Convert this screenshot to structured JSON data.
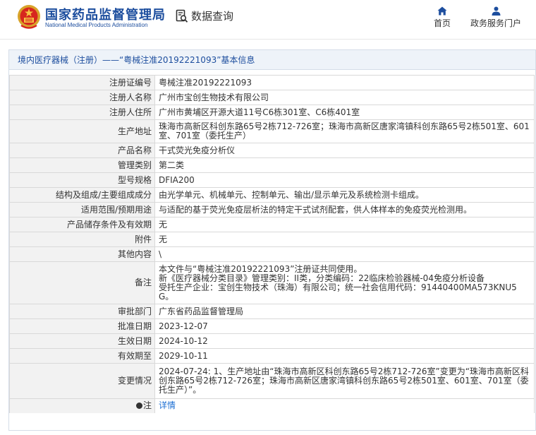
{
  "header": {
    "org_name_cn": "国家药品监督管理局",
    "org_name_en": "National Medical Products Administration",
    "data_query": "数据查询",
    "nav_home": "首页",
    "nav_portal": "政务服务门户"
  },
  "section": {
    "category": "境内医疗器械（注册）",
    "separator": "——",
    "title_rest": "“粤械注准20192221093”基本信息"
  },
  "rows": [
    {
      "label": "注册证编号",
      "value": "粤械注准20192221093"
    },
    {
      "label": "注册人名称",
      "value": "广州市宝创生物技术有限公司"
    },
    {
      "label": "注册人住所",
      "value": "广州市黄埔区开源大道11号C6栋301室、C6栋401室"
    },
    {
      "label": "生产地址",
      "value": "珠海市高新区科创东路65号2栋712-726室；珠海市高新区唐家湾镇科创东路65号2栋501室、601室、701室（委托生产）"
    },
    {
      "label": "产品名称",
      "value": "干式荧光免疫分析仪"
    },
    {
      "label": "管理类别",
      "value": "第二类"
    },
    {
      "label": "型号规格",
      "value": "DFIA200"
    },
    {
      "label": "结构及组成/主要组成成分",
      "value": "由光学单元、机械单元、控制单元、输出/显示单元及系统检测卡组成。"
    },
    {
      "label": "适用范围/预期用途",
      "value": "与适配的基于荧光免疫层析法的特定干式试剂配套，供人体样本的免疫荧光检测用。"
    },
    {
      "label": "产品储存条件及有效期",
      "value": "无"
    },
    {
      "label": "附件",
      "value": "无"
    },
    {
      "label": "其他内容",
      "value": "\\"
    },
    {
      "label": "备注",
      "value": "本文件与“粤械注准20192221093”注册证共同使用。\n新《医疗器械分类目录》管理类别：II类，分类编码：22临床检验器械-04免疫分析设备\n受托生产企业：宝创生物技术（珠海）有限公司；统一社会信用代码：91440400MA573KNU5G。"
    },
    {
      "label": "审批部门",
      "value": "广东省药品监督管理局"
    },
    {
      "label": "批准日期",
      "value": "2023-12-07"
    },
    {
      "label": "生效日期",
      "value": "2024-10-12"
    },
    {
      "label": "有效期至",
      "value": "2029-10-11"
    },
    {
      "label": "变更情况",
      "value": "2024-07-24: 1、生产地址由“珠海市高新区科创东路65号2栋712-726室”变更为“珠海市高新区科创东路65号2栋712-726室；珠海市高新区唐家湾镇科创东路65号2栋501室、601室、701室（委托生产）”。"
    }
  ],
  "note_row": {
    "label": "注",
    "value": "详情"
  },
  "icons": {
    "emblem": "national-emblem-icon",
    "query": "search-document-icon",
    "home": "home-icon",
    "portal": "user-icon"
  },
  "colors": {
    "brand_blue": "#1d4e9e",
    "link_blue": "#1d6fd3",
    "label_bg": "#f2f2f2",
    "title_bg": "#eef3f9"
  }
}
